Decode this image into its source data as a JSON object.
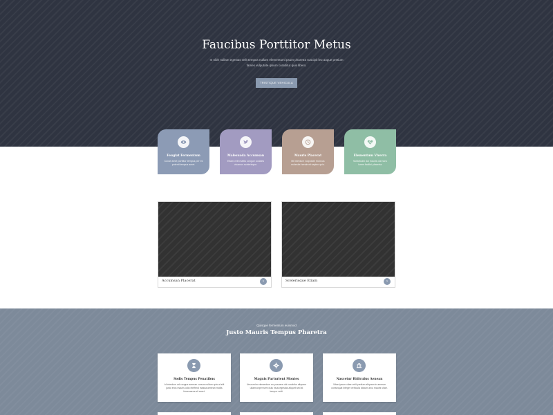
{
  "hero": {
    "title": "Faucibus Porttitor Metus",
    "subtitle": "In nibh nullam egestas velit tempus nullam elementum ipsum pharetra suscipit leo augue pretium fames vulputate ipsum curabitur quis libero.",
    "button_label": "TRISTIQUE VEHICULA"
  },
  "features": [
    {
      "title": "Feugiat Fermentum",
      "desc": "Curae amet porttitor tempus per mi potenti tempus amet.",
      "icon": "eye-icon",
      "color": "#8c9bb5"
    },
    {
      "title": "Malesuada Accumsan",
      "desc": "Etiam velit mattis congue sodales vivamus scelerisque.",
      "icon": "twitter-icon",
      "color": "#a29bc1"
    },
    {
      "title": "Mauris Placerat",
      "desc": "Mi interdum vulputate rhoncus molestie hendrerit sapien quis.",
      "icon": "history-icon",
      "color": "#b79f92"
    },
    {
      "title": "Elementum Viverra",
      "desc": "Sollicitudin dui mauris dui nunc lorem facilisi pharetra.",
      "icon": "heart-monitor-icon",
      "color": "#8fbea5"
    }
  ],
  "cards": [
    {
      "label": "Accumsan Placerat"
    },
    {
      "label": "Scelerisque Etiam"
    }
  ],
  "bottom": {
    "kicker": "Quisque fermentum euismod",
    "title": "Justo Mauris Tempus Pharetra"
  },
  "services": [
    {
      "title": "Sodis Tempus Penatibus",
      "desc": "Id interdum ad congue aenean cursus nullam quis at elit justo eros mauris odio eleifend massa aenean mollis himenaeos sit amet.",
      "icon": "hourglass-icon"
    },
    {
      "title": "Magnis Parturient Montes",
      "desc": "Uma enim elementum eu posuere dui curabitur aliquam ullamcorper sem duis risus egestas aliquet sed at tempor velit.",
      "icon": "gear-icon"
    },
    {
      "title": "Nascetur Ridiculus Aenean",
      "desc": "Vitae ipsum vitae velit pretium aliquam in aenean consequat integer vehicula dictum arcu mauris vitae.",
      "icon": "bank-icon"
    }
  ],
  "colors": {
    "hero_bg": "#2f3441",
    "bottom_bg": "#7d8a9a",
    "accent": "#8a9ab0"
  }
}
